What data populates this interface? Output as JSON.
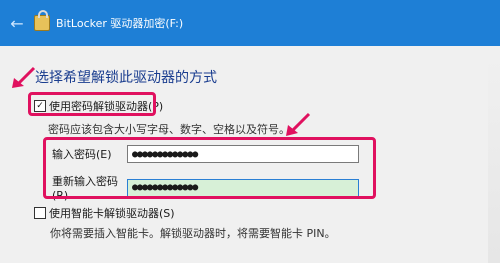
{
  "window": {
    "title": "BitLocker 驱动器加密(F:)"
  },
  "main": {
    "heading": "选择希望解锁此驱动器的方式",
    "password_option": {
      "label": "使用密码解锁驱动器(P)",
      "checked": true,
      "hint": "密码应该包含大小写字母、数字、空格以及符号。"
    },
    "fields": [
      {
        "label": "输入密码(E)",
        "value": "●●●●●●●●●●●●●"
      },
      {
        "label": "重新输入密码(R)",
        "value": "●●●●●●●●●●●●●"
      }
    ],
    "smartcard_option": {
      "label": "使用智能卡解锁驱动器(S)",
      "checked": false,
      "hint": "你将需要插入智能卡。解锁驱动器时，将需要智能卡 PIN。"
    }
  },
  "colors": {
    "titlebar": "#1e7fd6",
    "highlight": "#e0115f",
    "heading": "#1a3d8f"
  }
}
